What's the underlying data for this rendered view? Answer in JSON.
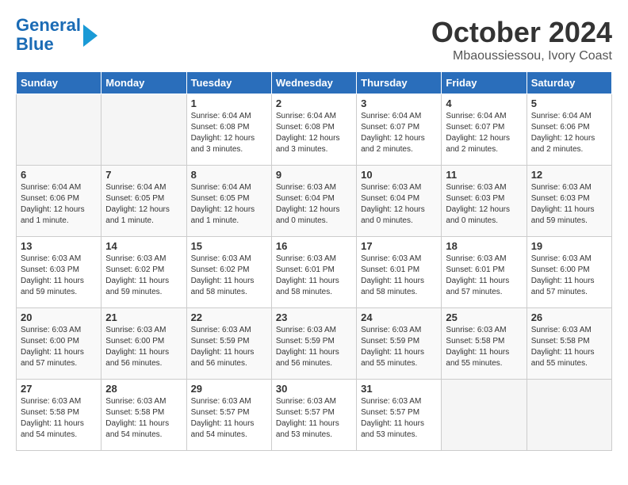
{
  "logo": {
    "line1": "General",
    "line2": "Blue"
  },
  "title": {
    "month": "October 2024",
    "location": "Mbaoussiessou, Ivory Coast"
  },
  "weekdays": [
    "Sunday",
    "Monday",
    "Tuesday",
    "Wednesday",
    "Thursday",
    "Friday",
    "Saturday"
  ],
  "weeks": [
    [
      {
        "day": null,
        "info": null
      },
      {
        "day": null,
        "info": null
      },
      {
        "day": "1",
        "info": "Sunrise: 6:04 AM\nSunset: 6:08 PM\nDaylight: 12 hours and 3 minutes."
      },
      {
        "day": "2",
        "info": "Sunrise: 6:04 AM\nSunset: 6:08 PM\nDaylight: 12 hours and 3 minutes."
      },
      {
        "day": "3",
        "info": "Sunrise: 6:04 AM\nSunset: 6:07 PM\nDaylight: 12 hours and 2 minutes."
      },
      {
        "day": "4",
        "info": "Sunrise: 6:04 AM\nSunset: 6:07 PM\nDaylight: 12 hours and 2 minutes."
      },
      {
        "day": "5",
        "info": "Sunrise: 6:04 AM\nSunset: 6:06 PM\nDaylight: 12 hours and 2 minutes."
      }
    ],
    [
      {
        "day": "6",
        "info": "Sunrise: 6:04 AM\nSunset: 6:06 PM\nDaylight: 12 hours and 1 minute."
      },
      {
        "day": "7",
        "info": "Sunrise: 6:04 AM\nSunset: 6:05 PM\nDaylight: 12 hours and 1 minute."
      },
      {
        "day": "8",
        "info": "Sunrise: 6:04 AM\nSunset: 6:05 PM\nDaylight: 12 hours and 1 minute."
      },
      {
        "day": "9",
        "info": "Sunrise: 6:03 AM\nSunset: 6:04 PM\nDaylight: 12 hours and 0 minutes."
      },
      {
        "day": "10",
        "info": "Sunrise: 6:03 AM\nSunset: 6:04 PM\nDaylight: 12 hours and 0 minutes."
      },
      {
        "day": "11",
        "info": "Sunrise: 6:03 AM\nSunset: 6:03 PM\nDaylight: 12 hours and 0 minutes."
      },
      {
        "day": "12",
        "info": "Sunrise: 6:03 AM\nSunset: 6:03 PM\nDaylight: 11 hours and 59 minutes."
      }
    ],
    [
      {
        "day": "13",
        "info": "Sunrise: 6:03 AM\nSunset: 6:03 PM\nDaylight: 11 hours and 59 minutes."
      },
      {
        "day": "14",
        "info": "Sunrise: 6:03 AM\nSunset: 6:02 PM\nDaylight: 11 hours and 59 minutes."
      },
      {
        "day": "15",
        "info": "Sunrise: 6:03 AM\nSunset: 6:02 PM\nDaylight: 11 hours and 58 minutes."
      },
      {
        "day": "16",
        "info": "Sunrise: 6:03 AM\nSunset: 6:01 PM\nDaylight: 11 hours and 58 minutes."
      },
      {
        "day": "17",
        "info": "Sunrise: 6:03 AM\nSunset: 6:01 PM\nDaylight: 11 hours and 58 minutes."
      },
      {
        "day": "18",
        "info": "Sunrise: 6:03 AM\nSunset: 6:01 PM\nDaylight: 11 hours and 57 minutes."
      },
      {
        "day": "19",
        "info": "Sunrise: 6:03 AM\nSunset: 6:00 PM\nDaylight: 11 hours and 57 minutes."
      }
    ],
    [
      {
        "day": "20",
        "info": "Sunrise: 6:03 AM\nSunset: 6:00 PM\nDaylight: 11 hours and 57 minutes."
      },
      {
        "day": "21",
        "info": "Sunrise: 6:03 AM\nSunset: 6:00 PM\nDaylight: 11 hours and 56 minutes."
      },
      {
        "day": "22",
        "info": "Sunrise: 6:03 AM\nSunset: 5:59 PM\nDaylight: 11 hours and 56 minutes."
      },
      {
        "day": "23",
        "info": "Sunrise: 6:03 AM\nSunset: 5:59 PM\nDaylight: 11 hours and 56 minutes."
      },
      {
        "day": "24",
        "info": "Sunrise: 6:03 AM\nSunset: 5:59 PM\nDaylight: 11 hours and 55 minutes."
      },
      {
        "day": "25",
        "info": "Sunrise: 6:03 AM\nSunset: 5:58 PM\nDaylight: 11 hours and 55 minutes."
      },
      {
        "day": "26",
        "info": "Sunrise: 6:03 AM\nSunset: 5:58 PM\nDaylight: 11 hours and 55 minutes."
      }
    ],
    [
      {
        "day": "27",
        "info": "Sunrise: 6:03 AM\nSunset: 5:58 PM\nDaylight: 11 hours and 54 minutes."
      },
      {
        "day": "28",
        "info": "Sunrise: 6:03 AM\nSunset: 5:58 PM\nDaylight: 11 hours and 54 minutes."
      },
      {
        "day": "29",
        "info": "Sunrise: 6:03 AM\nSunset: 5:57 PM\nDaylight: 11 hours and 54 minutes."
      },
      {
        "day": "30",
        "info": "Sunrise: 6:03 AM\nSunset: 5:57 PM\nDaylight: 11 hours and 53 minutes."
      },
      {
        "day": "31",
        "info": "Sunrise: 6:03 AM\nSunset: 5:57 PM\nDaylight: 11 hours and 53 minutes."
      },
      {
        "day": null,
        "info": null
      },
      {
        "day": null,
        "info": null
      }
    ]
  ]
}
